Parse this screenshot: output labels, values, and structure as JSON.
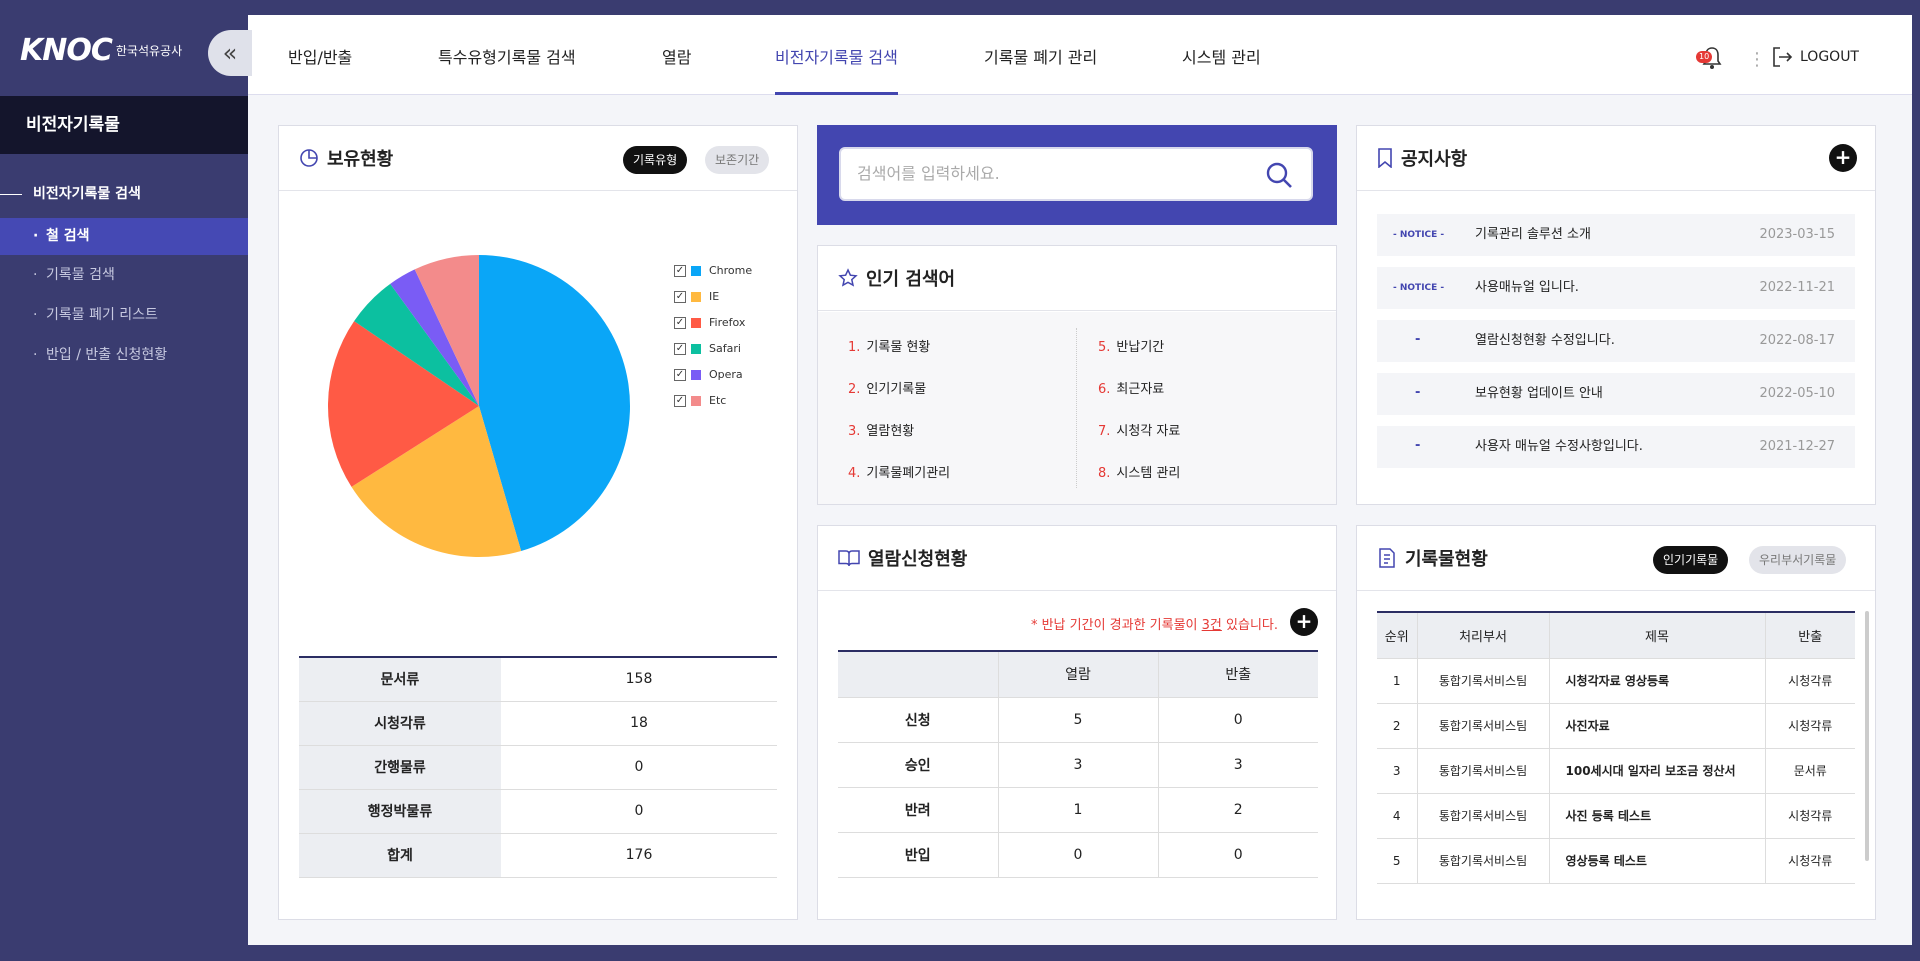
{
  "sidebar": {
    "logo": "KNOC",
    "logo_sub": "한국석유공사",
    "section_title": "비전자기록물",
    "group": "비전자기록물 검색",
    "items": [
      {
        "label": "철 검색",
        "active": true
      },
      {
        "label": "기록물 검색",
        "active": false
      },
      {
        "label": "기록물 폐기 리스트",
        "active": false
      },
      {
        "label": "반입 / 반출 신청현황",
        "active": false
      }
    ]
  },
  "nav": {
    "items": [
      {
        "label": "반입/반출",
        "active": false
      },
      {
        "label": "특수유형기록물 검색",
        "active": false
      },
      {
        "label": "열람",
        "active": false
      },
      {
        "label": "비전자기록물 검색",
        "active": true
      },
      {
        "label": "기록물 폐기 관리",
        "active": false
      },
      {
        "label": "시스템 관리",
        "active": false
      }
    ],
    "notification_count": "10",
    "logout_label": "LOGOUT"
  },
  "holdings": {
    "title": "보유현황",
    "tab_active": "기록유형",
    "tab_inactive": "보존기간",
    "rows": [
      {
        "label": "문서류",
        "value": "158"
      },
      {
        "label": "시청각류",
        "value": "18"
      },
      {
        "label": "간행물류",
        "value": "0"
      },
      {
        "label": "행정박물류",
        "value": "0"
      },
      {
        "label": "합계",
        "value": "176"
      }
    ]
  },
  "chart_data": {
    "type": "pie",
    "series": [
      {
        "name": "Chrome",
        "value": 45.5,
        "color": "#0aa6f7"
      },
      {
        "name": "IE",
        "value": 20.5,
        "color": "#ffb940"
      },
      {
        "name": "Firefox",
        "value": 18.5,
        "color": "#ff5a45"
      },
      {
        "name": "Safari",
        "value": 5.5,
        "color": "#0cc0a0"
      },
      {
        "name": "Opera",
        "value": 3.0,
        "color": "#7a5cf5"
      },
      {
        "name": "Etc",
        "value": 7.0,
        "color": "#f38b8b"
      }
    ],
    "legend_position": "right"
  },
  "search": {
    "placeholder": "검색어를 입력하세요."
  },
  "popular": {
    "title": "인기 검색어",
    "items": [
      {
        "n": "1.",
        "label": "기록물 현황"
      },
      {
        "n": "2.",
        "label": "인기기록물"
      },
      {
        "n": "3.",
        "label": "열람현황"
      },
      {
        "n": "4.",
        "label": "기록물폐기관리"
      },
      {
        "n": "5.",
        "label": "반납기간"
      },
      {
        "n": "6.",
        "label": "최근자료"
      },
      {
        "n": "7.",
        "label": "시청각 자료"
      },
      {
        "n": "8.",
        "label": "시스템 관리"
      }
    ]
  },
  "reading": {
    "title": "열람신청현황",
    "alert_prefix": "* 반납 기간이 경과한 기록물이 ",
    "alert_count": "3건",
    "alert_suffix": " 있습니다.",
    "headers": [
      "",
      "열람",
      "반출"
    ],
    "rows": [
      [
        "신청",
        "5",
        "0"
      ],
      [
        "승인",
        "3",
        "3"
      ],
      [
        "반려",
        "1",
        "2"
      ],
      [
        "반입",
        "0",
        "0"
      ]
    ]
  },
  "notices": {
    "title": "공지사항",
    "items": [
      {
        "tag": "- NOTICE -",
        "title": "기록관리 솔루션 소개",
        "date": "2023-03-15"
      },
      {
        "tag": "- NOTICE -",
        "title": "사용매뉴얼 입니다.",
        "date": "2022-11-21"
      },
      {
        "tag": "-",
        "title": "열람신청현황 수정입니다.",
        "date": "2022-08-17"
      },
      {
        "tag": "-",
        "title": "보유현황 업데이트 안내",
        "date": "2022-05-10"
      },
      {
        "tag": "-",
        "title": "사용자 매뉴얼 수정사항입니다.",
        "date": "2021-12-27"
      }
    ]
  },
  "records": {
    "title": "기록물현황",
    "tab_active": "인기기록물",
    "tab_inactive": "우리부서기록물",
    "headers": [
      "순위",
      "처리부서",
      "제목",
      "반출"
    ],
    "rows": [
      [
        "1",
        "통합기록서비스팀",
        "시청각자료 영상등록",
        "시청각류"
      ],
      [
        "2",
        "통합기록서비스팀",
        "사진자료",
        "시청각류"
      ],
      [
        "3",
        "통합기록서비스팀",
        "100세시대 일자리 보조금 정산서",
        "문서류"
      ],
      [
        "4",
        "통합기록서비스팀",
        "사진 등록 테스트",
        "시청각류"
      ],
      [
        "5",
        "통합기록서비스팀",
        "영상등록 테스트",
        "시청각류"
      ]
    ]
  }
}
